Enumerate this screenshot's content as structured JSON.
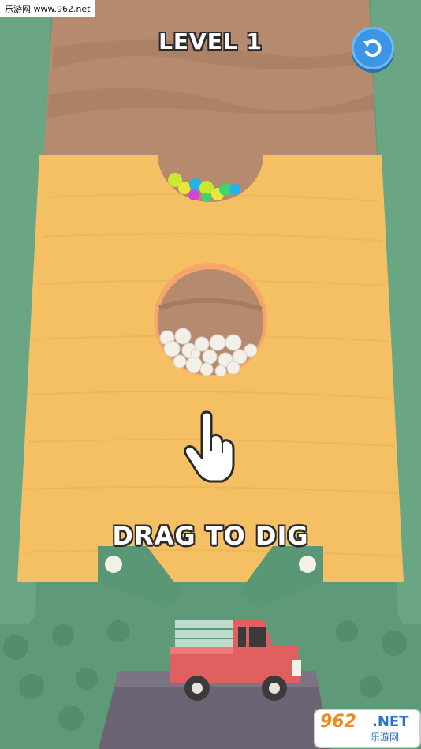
{
  "watermark_top": "乐游网 www.962.net",
  "level_title": "LEVEL 1",
  "hint_text": "DRAG TO DIG",
  "restart_icon": "restart-icon",
  "brand": {
    "number": "962",
    "net": ".NET",
    "cn": "乐游网"
  },
  "colors": {
    "sand": "#f4c063",
    "dirt": "#b58a6e",
    "grass": "#5f9a78",
    "truck": "#e06060",
    "button": "#3d95e6"
  }
}
